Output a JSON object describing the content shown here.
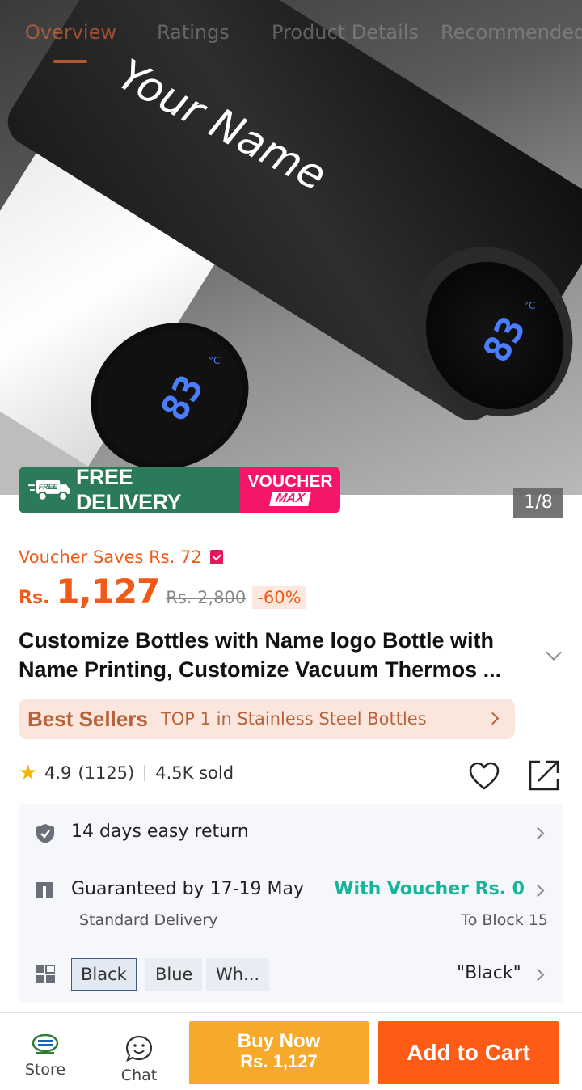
{
  "tabs": [
    {
      "label": "Overview",
      "active": true
    },
    {
      "label": "Ratings",
      "active": false
    },
    {
      "label": "Product Details",
      "active": false
    },
    {
      "label": "Recommended",
      "active": false
    }
  ],
  "hero": {
    "engraving": "Your Name",
    "display_reading": "83",
    "display_unit": "°C",
    "counter": "1/8"
  },
  "badge": {
    "free_tag": "FREE",
    "free_delivery": "FREE DELIVERY",
    "voucher_line1": "VOUCHER",
    "voucher_line2": "MAX"
  },
  "price": {
    "voucher_saves": "Voucher Saves Rs. 72",
    "currency": "Rs.",
    "current": "1,127",
    "original": "Rs. 2,800",
    "discount": "-60%"
  },
  "product": {
    "title": "Customize Bottles with Name logo Bottle with Name Printing, Customize Vacuum Thermos ..."
  },
  "best_sellers": {
    "label": "Best Sellers",
    "text": "TOP 1 in Stainless Steel Bottles"
  },
  "rating": {
    "score": "4.9",
    "count": "(1125)",
    "sold": "4.5K sold"
  },
  "info": {
    "return_text": "14 days easy return",
    "delivery_text": "Guaranteed by 17-19 May",
    "delivery_sub": "Standard Delivery",
    "voucher_text": "With Voucher Rs. 0",
    "location": "To Block 15",
    "variants": [
      "Black",
      "Blue",
      "Wh..."
    ],
    "selected_variant": "\"Black\""
  },
  "bottom_bar": {
    "store_label": "Store",
    "chat_label": "Chat",
    "buy_now": "Buy Now",
    "buy_now_price": "Rs. 1,127",
    "add_to_cart": "Add to Cart"
  },
  "colors": {
    "accent_orange": "#f05a16",
    "buy_now_bg": "#f7a92c",
    "add_to_cart_bg": "#fd5b16",
    "free_delivery_green": "#2b7b5a",
    "voucher_pink": "#f5156b",
    "voucher_teal": "#16b49a"
  }
}
